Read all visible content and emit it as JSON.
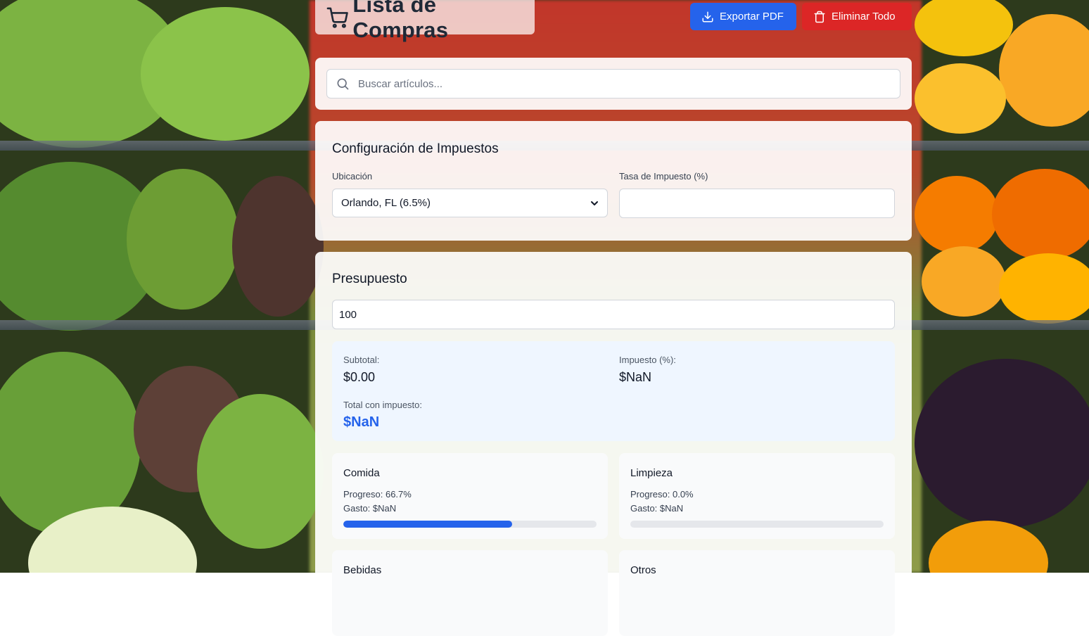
{
  "header": {
    "title": "Lista de Compras",
    "export_label": "Exportar PDF",
    "clear_label": "Eliminar Todo"
  },
  "search": {
    "placeholder": "Buscar artículos...",
    "value": ""
  },
  "tax": {
    "heading": "Configuración de Impuestos",
    "location_label": "Ubicación",
    "location_value": "Orlando, FL (6.5%)",
    "rate_label": "Tasa de Impuesto (%)",
    "rate_value": ""
  },
  "budget": {
    "heading": "Presupuesto",
    "value": "100",
    "summary": {
      "subtotal_label": "Subtotal:",
      "subtotal_value": "$0.00",
      "tax_label": "Impuesto (%):",
      "tax_value": "$NaN",
      "total_label": "Total con impuesto:",
      "total_value": "$NaN"
    },
    "categories": [
      {
        "name": "Comida",
        "progress_text": "Progreso: 66.7%",
        "spend_text": "Gasto: $NaN",
        "progress": 0.667
      },
      {
        "name": "Limpieza",
        "progress_text": "Progreso: 0.0%",
        "spend_text": "Gasto: $NaN",
        "progress": 0.0
      },
      {
        "name": "Bebidas",
        "progress_text": "",
        "spend_text": "",
        "progress": 0.0
      },
      {
        "name": "Otros",
        "progress_text": "",
        "spend_text": "",
        "progress": 0.0
      }
    ]
  },
  "colors": {
    "primary": "#2563eb",
    "danger": "#dc2626",
    "summary_bg": "#eff6ff"
  },
  "icons": {
    "cart": "shopping-cart-icon",
    "download": "download-icon",
    "trash": "trash-icon",
    "search": "search-icon",
    "chevron": "chevron-down-icon"
  }
}
